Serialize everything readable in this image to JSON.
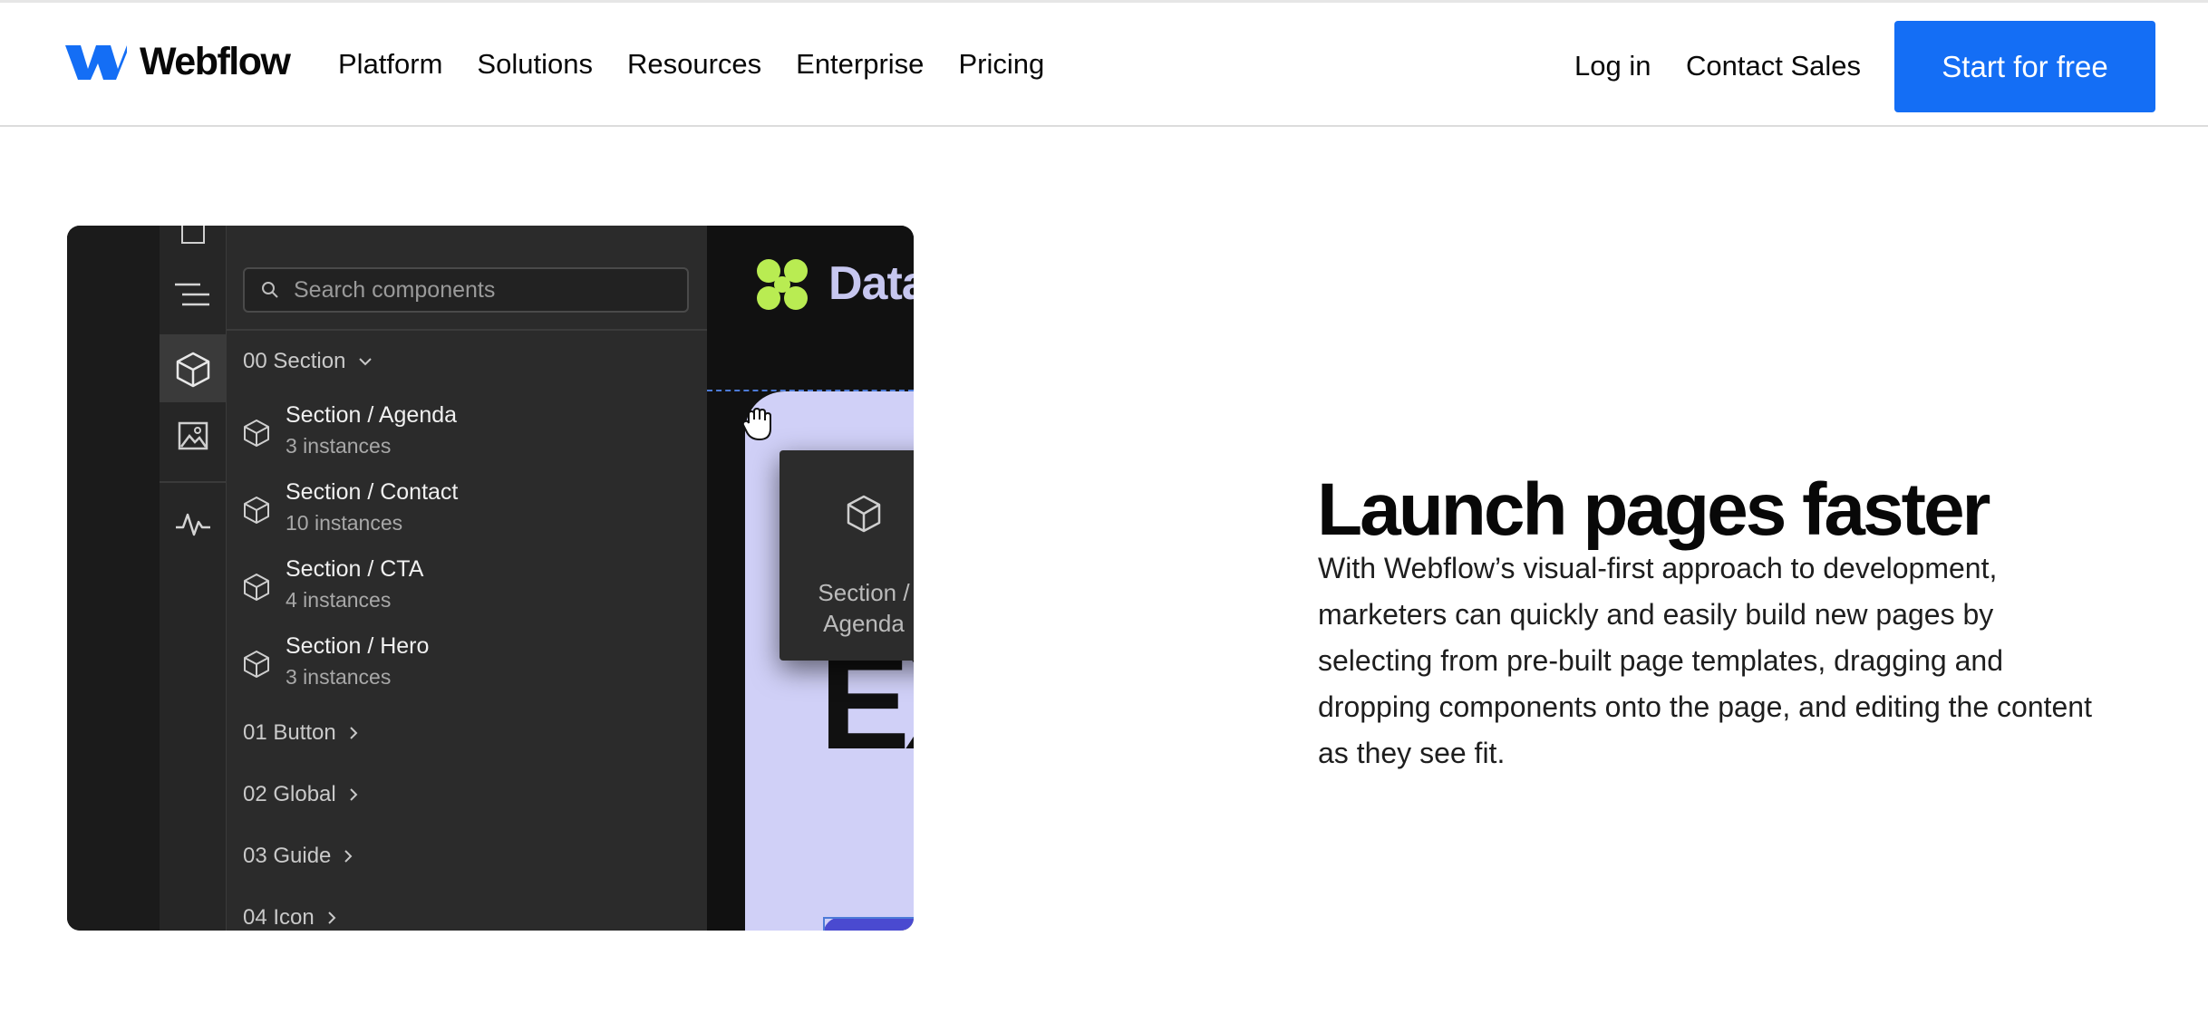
{
  "nav": {
    "brand": "Webflow",
    "links": [
      "Platform",
      "Solutions",
      "Resources",
      "Enterprise",
      "Pricing"
    ],
    "login": "Log in",
    "contact": "Contact Sales",
    "cta": "Start for free",
    "cta_color": "#146ef5"
  },
  "designer": {
    "search_placeholder": "Search components",
    "groups": [
      {
        "label": "00 Section",
        "expanded": true
      },
      {
        "label": "01 Button",
        "expanded": false
      },
      {
        "label": "02 Global",
        "expanded": false
      },
      {
        "label": "03 Guide",
        "expanded": false
      },
      {
        "label": "04 Icon",
        "expanded": false
      }
    ],
    "components": [
      {
        "name": "Section / Agenda",
        "count": "3 instances"
      },
      {
        "name": "Section / Contact",
        "count": "10 instances"
      },
      {
        "name": "Section / CTA",
        "count": "4 instances"
      },
      {
        "name": "Section / Hero",
        "count": "3 instances"
      }
    ],
    "canvas": {
      "brand_text": "DataS",
      "hero_text": "EX",
      "drag_label_line1": "Section /",
      "drag_label_line2": "Agenda"
    }
  },
  "content": {
    "heading": "Launch pages faster",
    "body": "With Webflow’s visual-first approach to development, marketers can quickly and easily build new pages by selecting from pre-built page templates, dragging and dropping components onto the page, and editing the content as they see fit."
  }
}
